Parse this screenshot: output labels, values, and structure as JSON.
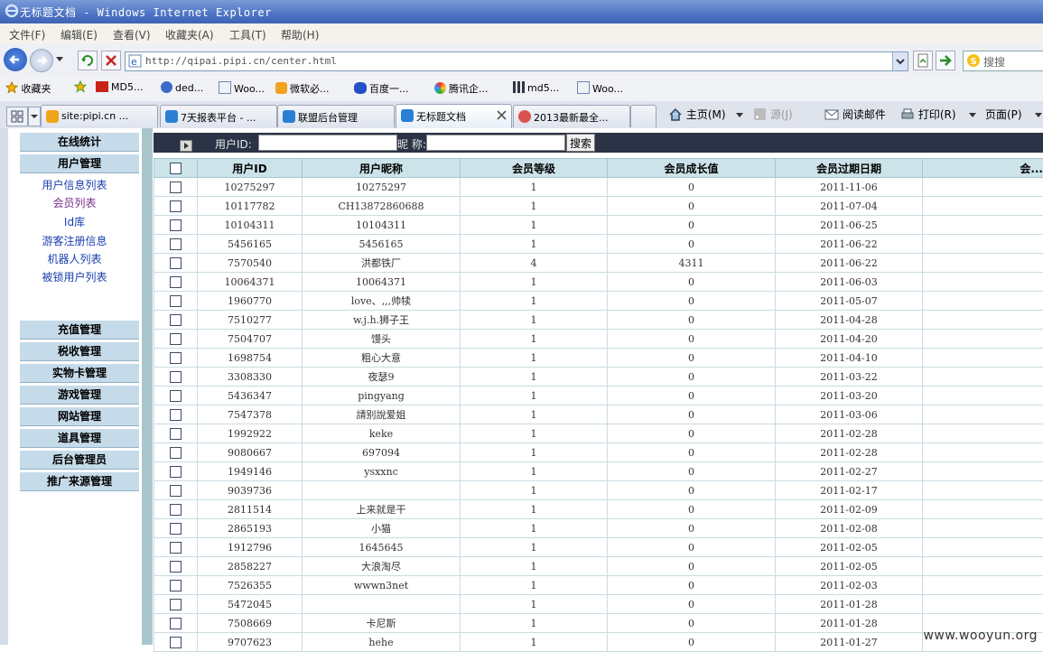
{
  "window": {
    "title": "无标题文档 - Windows Internet Explorer"
  },
  "menu": [
    "文件(F)",
    "编辑(E)",
    "查看(V)",
    "收藏夹(A)",
    "工具(T)",
    "帮助(H)"
  ],
  "address": {
    "url": "http://qipai.pipi.cn/center.html",
    "search_placeholder": "搜搜"
  },
  "favorites": [
    "收藏夹",
    "MD5...",
    "ded...",
    "Woo...",
    "微软必...",
    "百度一...",
    "腾讯企...",
    "md5...",
    "Woo..."
  ],
  "tabs": [
    "site:pipi.cn ...",
    "7天报表平台 - ...",
    "联盟后台管理",
    "无标题文档",
    "2013最新最全..."
  ],
  "commands": {
    "home": "主页(M)",
    "feeds": "源(J)",
    "mail": "阅读邮件",
    "print": "打印(R)",
    "page": "页面(P)"
  },
  "sidebar": {
    "top": [
      "在线统计",
      "用户管理"
    ],
    "links": [
      "用户信息列表",
      "会员列表",
      "Id库",
      "游客注册信息",
      "机器人列表",
      "被锁用户列表"
    ],
    "sections": [
      "充值管理",
      "税收管理",
      "实物卡管理",
      "游戏管理",
      "网站管理",
      "道具管理",
      "后台管理员",
      "推广来源管理"
    ]
  },
  "search": {
    "uid_label": "用户ID:",
    "nick_label": "昵 称:",
    "button": "搜索"
  },
  "table": {
    "headers": [
      "用户ID",
      "用户昵称",
      "会员等级",
      "会员成长值",
      "会员过期日期",
      "会..."
    ],
    "rows": [
      [
        "10275297",
        "10275297",
        "1",
        "0",
        "2011-11-06"
      ],
      [
        "10117782",
        "CH13872860688",
        "1",
        "0",
        "2011-07-04"
      ],
      [
        "10104311",
        "10104311",
        "1",
        "0",
        "2011-06-25"
      ],
      [
        "5456165",
        "5456165",
        "1",
        "0",
        "2011-06-22"
      ],
      [
        "7570540",
        "洪都铁厂",
        "4",
        "4311",
        "2011-06-22"
      ],
      [
        "10064371",
        "10064371",
        "1",
        "0",
        "2011-06-03"
      ],
      [
        "1960770",
        "love、‚‚‚帅犊",
        "1",
        "0",
        "2011-05-07"
      ],
      [
        "7510277",
        "w.j.h.狮子王",
        "1",
        "0",
        "2011-04-28"
      ],
      [
        "7504707",
        "馒头",
        "1",
        "0",
        "2011-04-20"
      ],
      [
        "1698754",
        "粗心大意",
        "1",
        "0",
        "2011-04-10"
      ],
      [
        "3308330",
        "夜瑟9",
        "1",
        "0",
        "2011-03-22"
      ],
      [
        "5436347",
        "pingyang",
        "1",
        "0",
        "2011-03-20"
      ],
      [
        "7547378",
        "請别說爱姐",
        "1",
        "0",
        "2011-03-06"
      ],
      [
        "1992922",
        "keke",
        "1",
        "0",
        "2011-02-28"
      ],
      [
        "9080667",
        "697094",
        "1",
        "0",
        "2011-02-28"
      ],
      [
        "1949146",
        "ysxxnc",
        "1",
        "0",
        "2011-02-27"
      ],
      [
        "9039736",
        "",
        "1",
        "0",
        "2011-02-17"
      ],
      [
        "2811514",
        "上来就是干",
        "1",
        "0",
        "2011-02-09"
      ],
      [
        "2865193",
        "小猫",
        "1",
        "0",
        "2011-02-08"
      ],
      [
        "1912796",
        "1645645",
        "1",
        "0",
        "2011-02-05"
      ],
      [
        "2858227",
        "大浪淘尽",
        "1",
        "0",
        "2011-02-05"
      ],
      [
        "7526355",
        "wwwn3net",
        "1",
        "0",
        "2011-02-03"
      ],
      [
        "5472045",
        "",
        "1",
        "0",
        "2011-01-28"
      ],
      [
        "7508669",
        "卡尼斯",
        "1",
        "0",
        "2011-01-28"
      ],
      [
        "9707623",
        "hehe",
        "1",
        "0",
        "2011-01-27"
      ]
    ]
  },
  "watermark": "www.wooyun.org"
}
